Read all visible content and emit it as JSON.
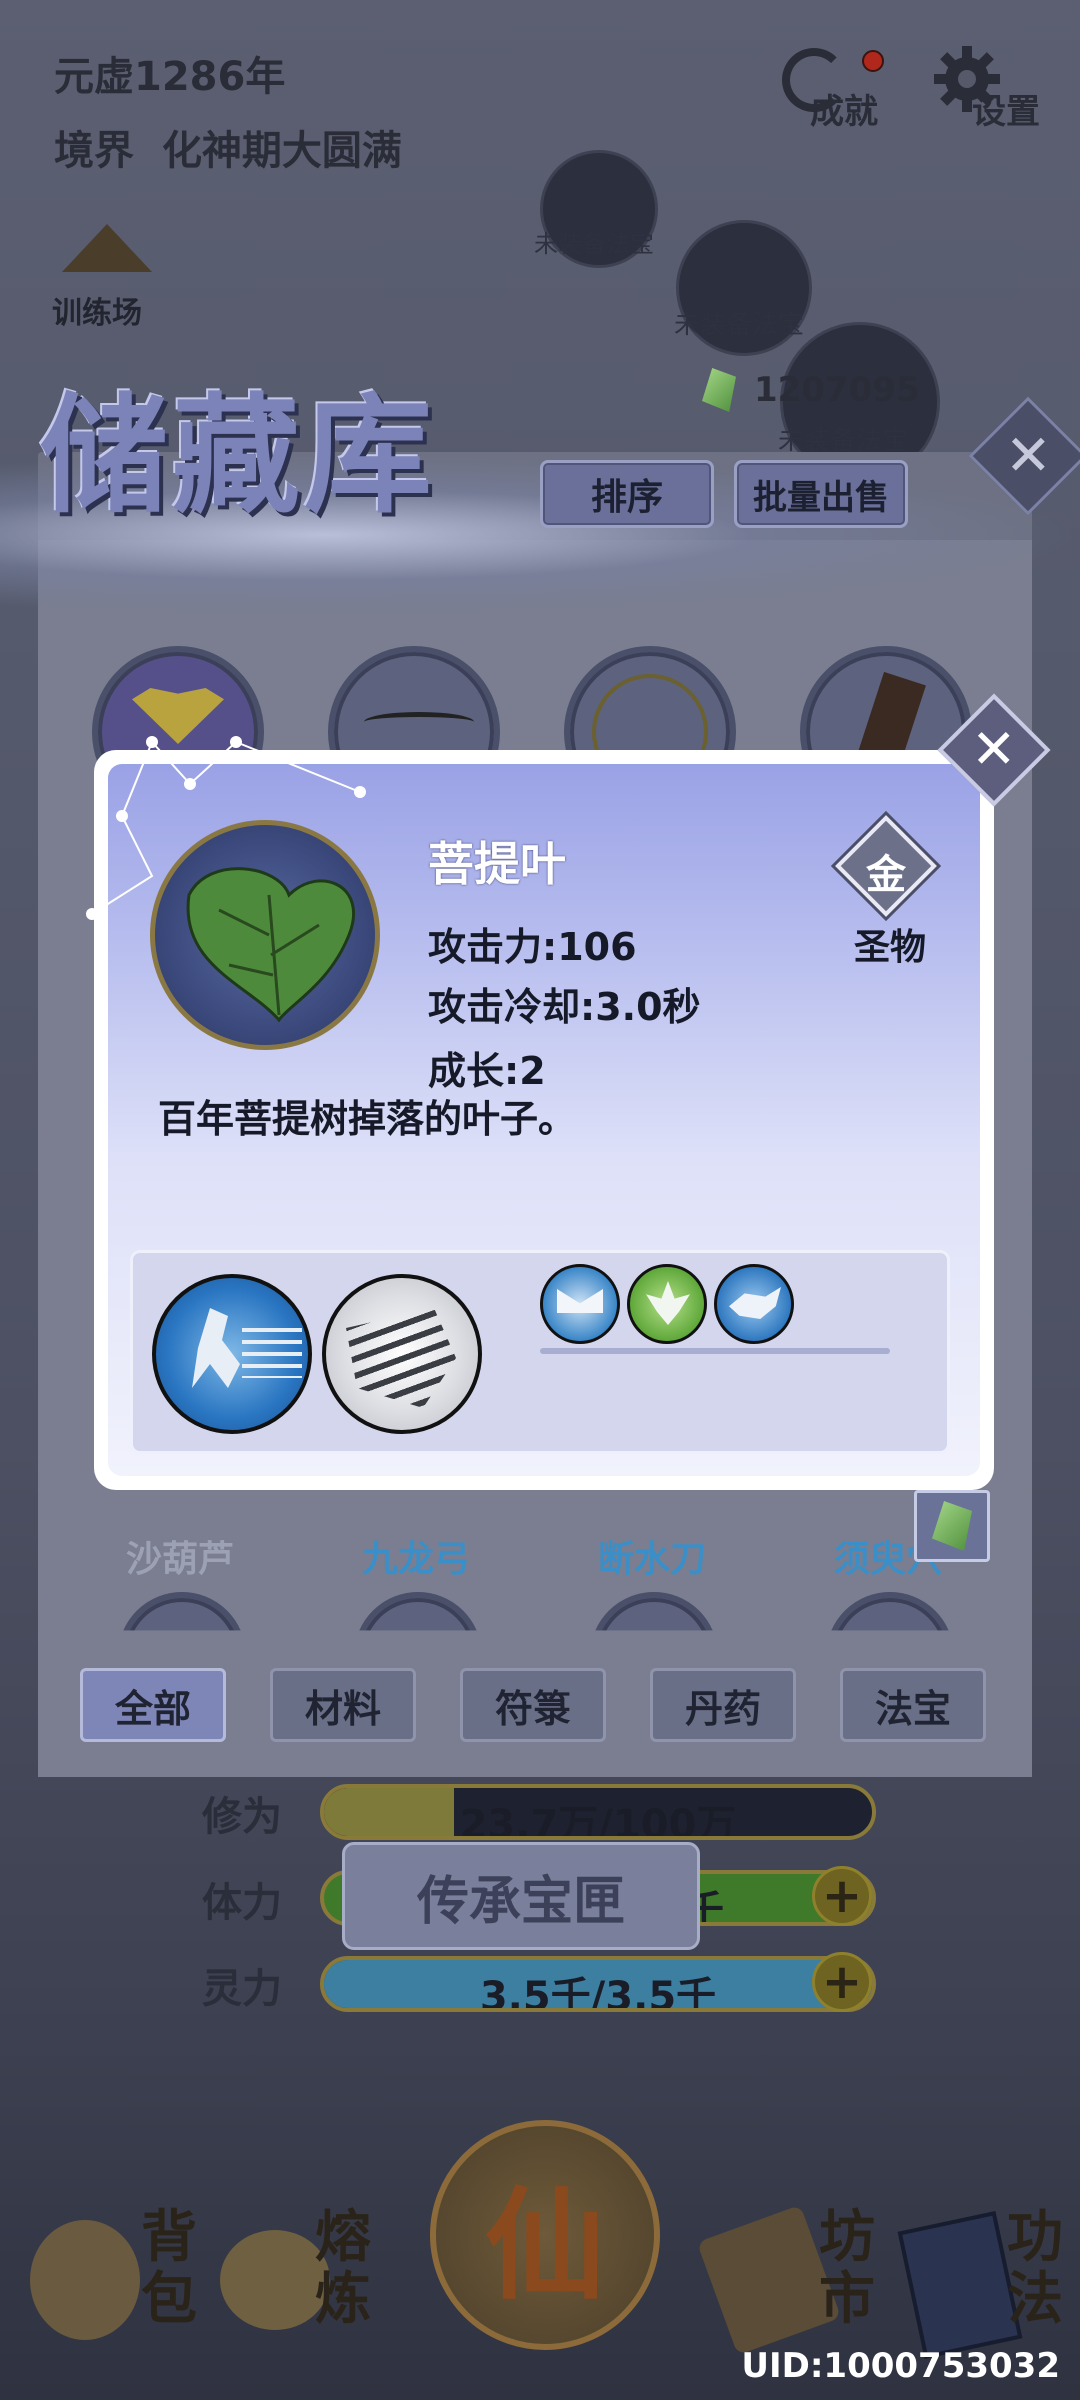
{
  "header": {
    "era": "元虚1286年",
    "realm_label": "境界",
    "realm_value": "化神期大圆满",
    "achievements_label": "成就",
    "settings_label": "设置",
    "training_label": "训练场"
  },
  "equipment_slots": [
    {
      "label": "未装备法宝"
    },
    {
      "label": "未装备法宝"
    },
    {
      "label": "未装备法宝"
    }
  ],
  "currency": {
    "amount": "1207095",
    "icon": "spirit-stone-icon"
  },
  "storage": {
    "title": "储藏库",
    "sort_label": "排序",
    "bulk_sell_label": "批量出售",
    "close_glyph": "✕",
    "visible_item_names": [
      {
        "name": "沙葫芦",
        "color": "#9da1b4"
      },
      {
        "name": "九龙弓",
        "color": "#3a8fc8"
      },
      {
        "name": "断水刀",
        "color": "#3a8fc8"
      },
      {
        "name": "须臾穴",
        "color": "#3a8fc8"
      }
    ],
    "tabs": [
      {
        "label": "全部",
        "active": true
      },
      {
        "label": "材料",
        "active": false
      },
      {
        "label": "符箓",
        "active": false
      },
      {
        "label": "丹药",
        "active": false
      },
      {
        "label": "法宝",
        "active": false
      }
    ]
  },
  "stats": {
    "cultivation": {
      "label": "修为",
      "text": "23.7万/100万",
      "fill": 0.237,
      "color": "#7d7a3a"
    },
    "stamina": {
      "label": "体力",
      "text": "千",
      "color": "#3f7a2a"
    },
    "spirit": {
      "label": "灵力",
      "text": "3.5千/3.5千",
      "fill": 1.0,
      "color": "#3d7fa0"
    }
  },
  "legacy_button": "传承宝匣",
  "nav": {
    "backpack": "背包",
    "smelt": "熔炼",
    "center": "仙",
    "market": "坊市",
    "techniques": "功法"
  },
  "uid": "UID:1000753032",
  "item_detail": {
    "name": "菩提叶",
    "attack": "攻击力:106",
    "cooldown": "攻击冷却:3.0秒",
    "growth": "成长:2",
    "description": "百年菩提树掉落的叶子。",
    "grade_glyph": "金",
    "rarity": "圣物",
    "close_glyph": "✕"
  },
  "colors": {
    "accent": "#7e86b8",
    "popup_top": "#9aa2e6",
    "blue_item": "#3a8fc8"
  }
}
